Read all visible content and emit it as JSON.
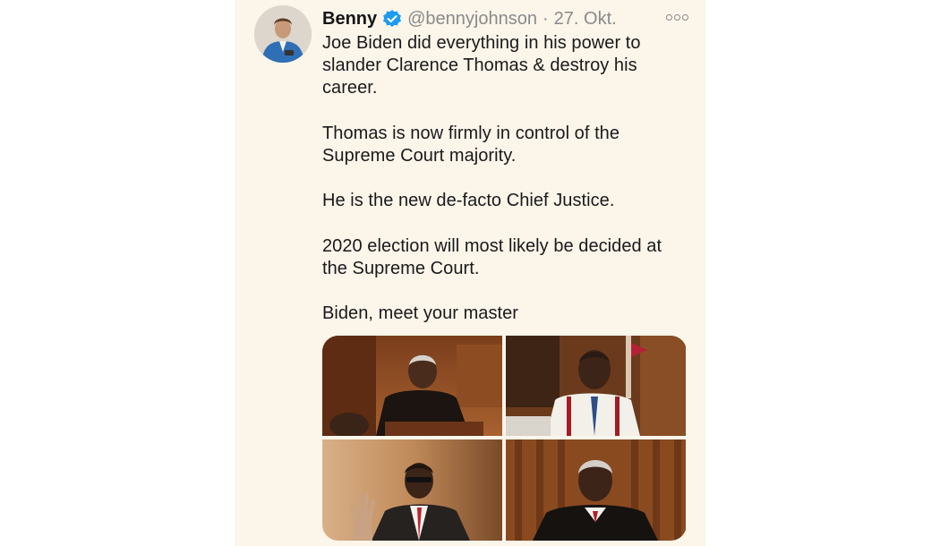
{
  "tweet": {
    "author_name": "Benny",
    "handle": "@bennyjohnson",
    "separator": "·",
    "date": "27. Okt.",
    "verified_icon": "verified-badge-icon",
    "more_icon": "more-options-icon",
    "paragraphs": [
      "Joe Biden did everything in his power to slander Clarence Thomas & destroy his career.",
      "Thomas is now firmly in control of the Supreme Court majority.",
      "He is the new de-facto Chief Justice.",
      "2020 election will most likely be decided at the Supreme Court.",
      "Biden, meet your master"
    ],
    "media": [
      {
        "name": "photo-judge-at-bench",
        "icon": "photo-icon"
      },
      {
        "name": "photo-man-in-office",
        "icon": "photo-icon"
      },
      {
        "name": "photo-man-taking-oath",
        "icon": "photo-icon"
      },
      {
        "name": "photo-judge-portrait",
        "icon": "photo-icon"
      }
    ]
  },
  "colors": {
    "card_background": "#fbf5ea",
    "text": "#1a1a1a",
    "secondary_text": "#8a8a8a",
    "verified_blue": "#1d9bf0"
  }
}
